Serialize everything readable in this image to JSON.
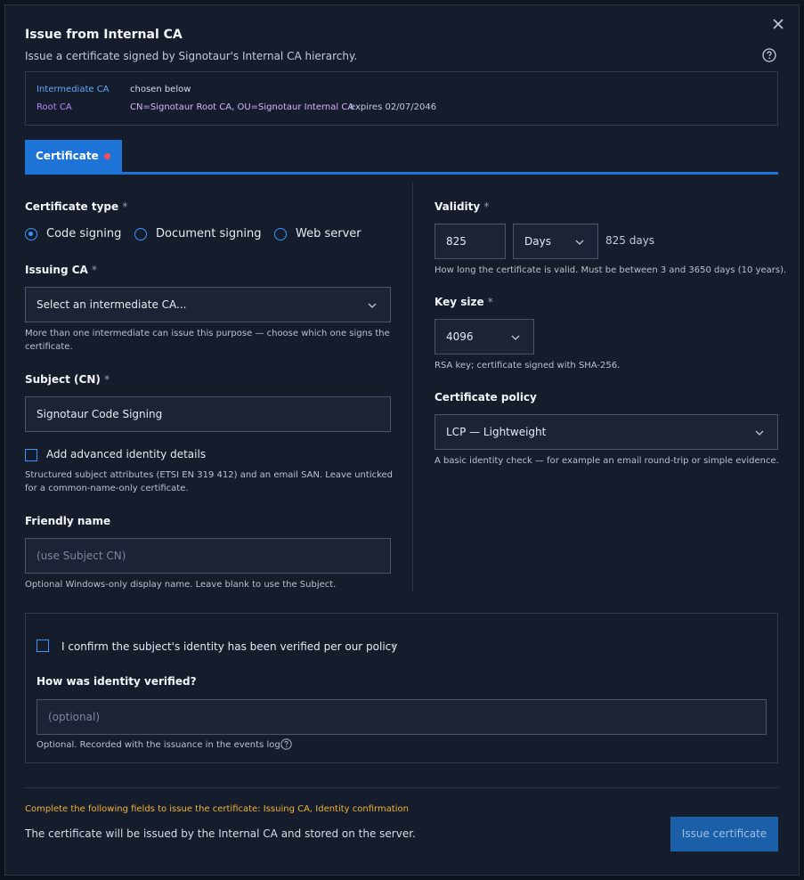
{
  "dialog": {
    "title": "Issue from Internal CA",
    "subtitle": "Issue a certificate signed by Signotaur's Internal CA hierarchy."
  },
  "ca_info": {
    "intermediate_label": "Intermediate CA",
    "intermediate_value": "chosen below",
    "root_label": "Root CA",
    "root_value": "CN=Signotaur Root CA, OU=Signotaur Internal CA",
    "root_expiry": "expires 02/07/2046"
  },
  "tabs": [
    {
      "label": "Certificate",
      "active": true,
      "has_error": true
    }
  ],
  "form": {
    "required_marker": "*",
    "certificate_type": {
      "label": "Certificate type",
      "options": [
        "Code signing",
        "Document signing",
        "Web server"
      ],
      "selected": "Code signing"
    },
    "issuing_ca": {
      "label": "Issuing CA",
      "value": "Select an intermediate CA...",
      "help": "More than one intermediate can issue this purpose — choose which one signs the certificate."
    },
    "subject": {
      "label": "Subject (CN)",
      "value": "Signotaur Code Signing"
    },
    "advanced_identity": {
      "label": "Add advanced identity details",
      "checked": false,
      "help": "Structured subject attributes (ETSI EN 319 412) and an email SAN. Leave unticked for a common-name-only certificate."
    },
    "friendly_name": {
      "label": "Friendly name",
      "value": "",
      "placeholder": "(use Subject CN)",
      "help": "Optional Windows-only display name. Leave blank to use the Subject."
    },
    "validity": {
      "label": "Validity",
      "value": "825",
      "unit": "Days",
      "summary": "825 days",
      "help": "How long the certificate is valid. Must be between 3 and 3650 days (10 years)."
    },
    "key_size": {
      "label": "Key size",
      "value": "4096",
      "help": "RSA key; certificate signed with SHA-256."
    },
    "policy": {
      "label": "Certificate policy",
      "value": "LCP — Lightweight",
      "help": "A basic identity check — for example an email round-trip or simple evidence."
    }
  },
  "confirmation": {
    "checkbox_label": "I confirm the subject's identity has been verified per our policy",
    "checked": false,
    "method_label": "How was identity verified?",
    "method_value": "",
    "method_placeholder": "(optional)",
    "method_help": "Optional. Recorded with the issuance in the events log."
  },
  "footer": {
    "warning": "Complete the following fields to issue the certificate: Issuing CA, Identity confirmation",
    "note": "The certificate will be issued by the Internal CA and stored on the server.",
    "submit_label": "Issue certificate"
  },
  "colors": {
    "accent": "#1e74d6",
    "error_dot": "#ff4d55",
    "warning": "#f2b233",
    "root_ca": "#b586ff",
    "intermediate_ca": "#5fa8ff"
  }
}
